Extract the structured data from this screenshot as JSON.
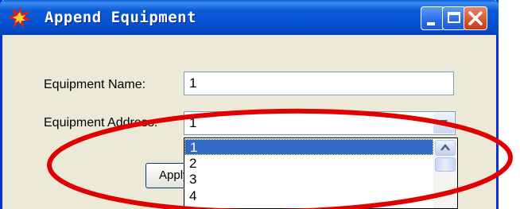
{
  "window": {
    "title": "Append Equipment"
  },
  "form": {
    "name_label": "Equipment Name:",
    "name_value": "1",
    "address_label": "Equipment Address:",
    "address_value": "1"
  },
  "dropdown": {
    "options": [
      "1",
      "2",
      "3",
      "4"
    ],
    "selected": "1"
  },
  "apply_button": {
    "label": "Apply"
  },
  "colors": {
    "titlebar": "#0a5ad6",
    "selection": "#316ac5",
    "annotation": "#e00000",
    "window_bg": "#ece9d8"
  },
  "icons": [
    "app-burst-icon",
    "minimize-icon",
    "maximize-icon",
    "close-icon",
    "dropdown-arrow-icon",
    "scroll-up-icon"
  ]
}
